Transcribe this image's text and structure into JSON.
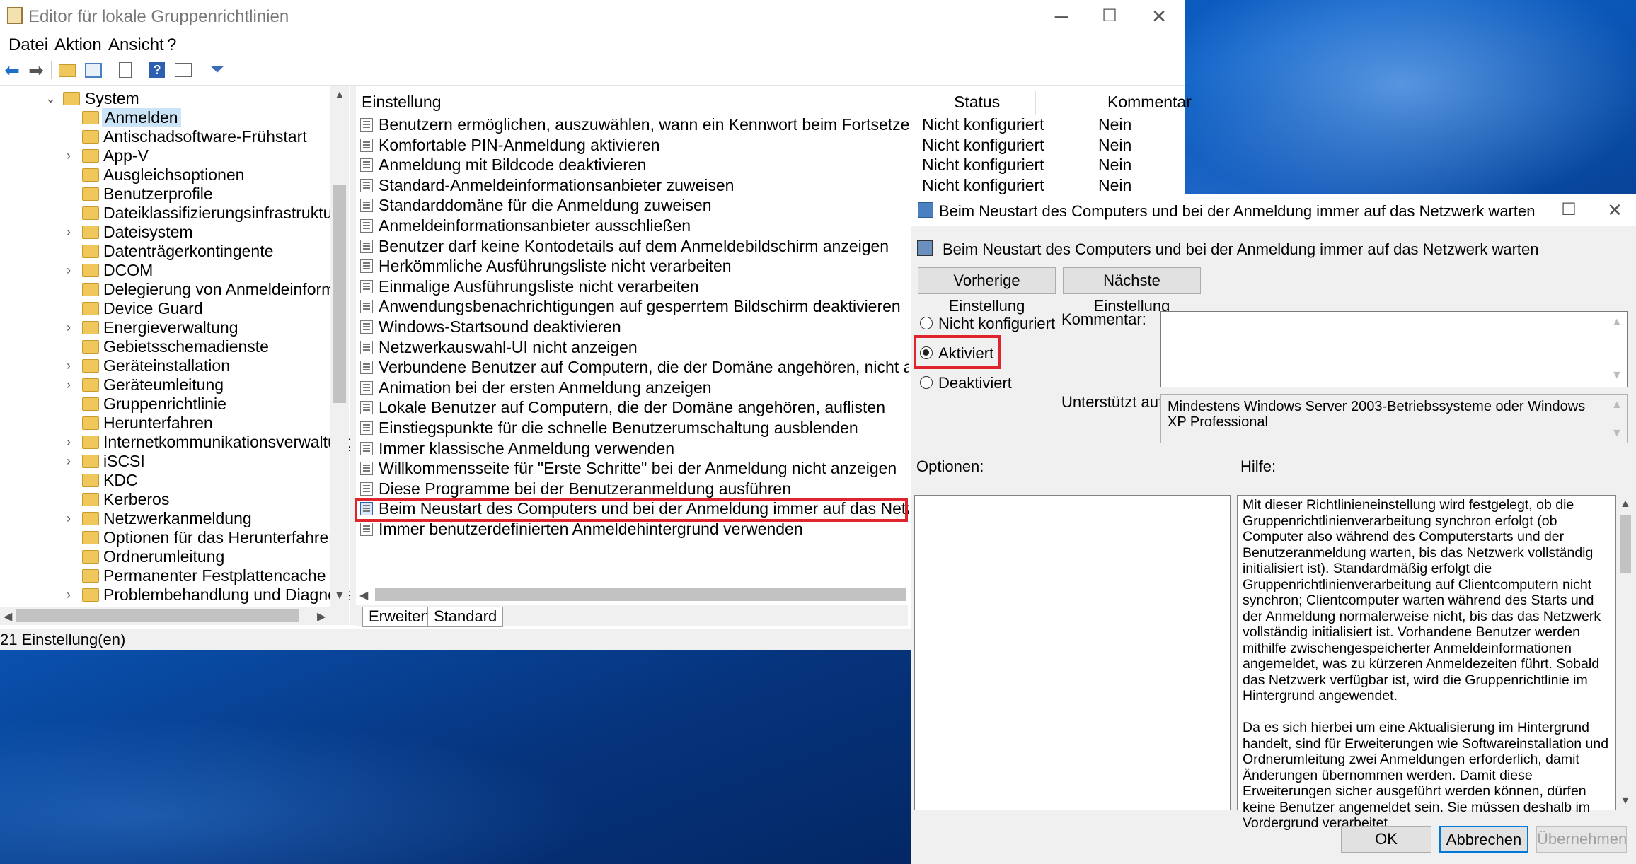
{
  "window": {
    "title": "Editor für lokale Gruppenrichtlinien",
    "minimize": "─",
    "maximize": "☐",
    "close": "✕"
  },
  "menu": {
    "items": [
      "Datei",
      "Aktion",
      "Ansicht",
      "?"
    ]
  },
  "toolbar": {
    "icons": [
      "back-icon",
      "forward-icon",
      "up-folder-icon",
      "show-hide-tree-icon",
      "export-list-icon",
      "help-icon",
      "properties-icon",
      "filter-icon"
    ]
  },
  "tree": {
    "root": "System",
    "items": [
      {
        "label": "Anmelden",
        "expandable": false,
        "selected": true
      },
      {
        "label": "Antischadsoftware-Frühstart",
        "expandable": false
      },
      {
        "label": "App-V",
        "expandable": true
      },
      {
        "label": "Ausgleichsoptionen",
        "expandable": false
      },
      {
        "label": "Benutzerprofile",
        "expandable": false
      },
      {
        "label": "Dateiklassifizierungsinfrastruktur",
        "expandable": false
      },
      {
        "label": "Dateisystem",
        "expandable": true
      },
      {
        "label": "Datenträgerkontingente",
        "expandable": false
      },
      {
        "label": "DCOM",
        "expandable": true
      },
      {
        "label": "Delegierung von Anmeldeinformationer",
        "expandable": false
      },
      {
        "label": "Device Guard",
        "expandable": false
      },
      {
        "label": "Energieverwaltung",
        "expandable": true
      },
      {
        "label": "Gebietsschemadienste",
        "expandable": false
      },
      {
        "label": "Geräteinstallation",
        "expandable": true
      },
      {
        "label": "Geräteumleitung",
        "expandable": true
      },
      {
        "label": "Gruppenrichtlinie",
        "expandable": false
      },
      {
        "label": "Herunterfahren",
        "expandable": false
      },
      {
        "label": "Internetkommunikationsverwaltung",
        "expandable": true
      },
      {
        "label": "iSCSI",
        "expandable": true
      },
      {
        "label": "KDC",
        "expandable": false
      },
      {
        "label": "Kerberos",
        "expandable": false
      },
      {
        "label": "Netzwerkanmeldung",
        "expandable": true
      },
      {
        "label": "Optionen für das Herunterfahren",
        "expandable": false
      },
      {
        "label": "Ordnerumleitung",
        "expandable": false
      },
      {
        "label": "Permanenter Festplattencache",
        "expandable": false
      },
      {
        "label": "Problembehandlung und Diagnose",
        "expandable": true
      }
    ]
  },
  "list": {
    "columns": {
      "setting": "Einstellung",
      "status": "Status",
      "comment": "Kommentar"
    },
    "rows": [
      {
        "name": "Benutzern ermöglichen, auszuwählen, wann ein Kennwort beim Fortsetzen aus dem Verbind...",
        "status": "Nicht konfiguriert",
        "comment": "Nein"
      },
      {
        "name": "Komfortable PIN-Anmeldung aktivieren",
        "status": "Nicht konfiguriert",
        "comment": "Nein"
      },
      {
        "name": "Anmeldung mit Bildcode deaktivieren",
        "status": "Nicht konfiguriert",
        "comment": "Nein"
      },
      {
        "name": "Standard-Anmeldeinformationsanbieter zuweisen",
        "status": "Nicht konfiguriert",
        "comment": "Nein"
      },
      {
        "name": "Standarddomäne für die Anmeldung zuweisen",
        "status": "",
        "comment": ""
      },
      {
        "name": "Anmeldeinformationsanbieter ausschließen",
        "status": "",
        "comment": ""
      },
      {
        "name": "Benutzer darf keine Kontodetails auf dem Anmeldebildschirm anzeigen",
        "status": "",
        "comment": ""
      },
      {
        "name": "Herkömmliche Ausführungsliste nicht verarbeiten",
        "status": "",
        "comment": ""
      },
      {
        "name": "Einmalige Ausführungsliste nicht verarbeiten",
        "status": "",
        "comment": ""
      },
      {
        "name": "Anwendungsbenachrichtigungen auf gesperrtem Bildschirm deaktivieren",
        "status": "",
        "comment": ""
      },
      {
        "name": "Windows-Startsound deaktivieren",
        "status": "",
        "comment": ""
      },
      {
        "name": "Netzwerkauswahl-UI nicht anzeigen",
        "status": "",
        "comment": ""
      },
      {
        "name": "Verbundene Benutzer auf Computern, die der Domäne angehören, nicht auflisten",
        "status": "",
        "comment": ""
      },
      {
        "name": "Animation bei der ersten Anmeldung anzeigen",
        "status": "",
        "comment": ""
      },
      {
        "name": "Lokale Benutzer auf Computern, die der Domäne angehören, auflisten",
        "status": "",
        "comment": ""
      },
      {
        "name": "Einstiegspunkte für die schnelle Benutzerumschaltung ausblenden",
        "status": "",
        "comment": ""
      },
      {
        "name": "Immer klassische Anmeldung verwenden",
        "status": "",
        "comment": ""
      },
      {
        "name": "Willkommensseite für \"Erste Schritte\" bei der Anmeldung nicht anzeigen",
        "status": "",
        "comment": ""
      },
      {
        "name": "Diese Programme bei der Benutzeranmeldung ausführen",
        "status": "",
        "comment": ""
      },
      {
        "name": "Beim Neustart des Computers und bei der Anmeldung immer auf das Netzwerk warten",
        "status": "",
        "comment": "",
        "highlighted": true
      },
      {
        "name": "Immer benutzerdefinierten Anmeldehintergrund verwenden",
        "status": "",
        "comment": ""
      }
    ]
  },
  "tabs": [
    "Erweitert",
    "Standard"
  ],
  "statusbar": {
    "text": "21 Einstellung(en)"
  },
  "dialog": {
    "title": "Beim Neustart des Computers und bei der Anmeldung immer auf das Netzwerk warten",
    "heading": "Beim Neustart des Computers und bei der Anmeldung immer auf das Netzwerk warten",
    "prev_button": "Vorherige Einstellung",
    "next_button": "Nächste Einstellung",
    "radio_not_configured": "Nicht konfiguriert",
    "radio_enabled": "Aktiviert",
    "radio_disabled": "Deaktiviert",
    "selected_option": "Aktiviert",
    "comment_label": "Kommentar:",
    "comment_value": "",
    "supported_label": "Unterstützt auf:",
    "supported_value": "Mindestens Windows Server 2003-Betriebssysteme oder Windows XP Professional",
    "options_label": "Optionen:",
    "help_label": "Hilfe:",
    "help_text": "Mit dieser Richtlinieneinstellung wird festgelegt, ob die Gruppenrichtlinienverarbeitung synchron erfolgt (ob Computer also während des Computerstarts und der Benutzeranmeldung warten, bis das Netzwerk vollständig initialisiert ist). Standardmäßig erfolgt die Gruppenrichtlinienverarbeitung auf Clientcomputern nicht synchron; Clientcomputer warten während des Starts und der Anmeldung normalerweise nicht, bis das das Netzwerk vollständig initialisiert ist. Vorhandene Benutzer werden mithilfe zwischengespeicherter Anmeldeinformationen angemeldet, was zu kürzeren Anmeldezeiten führt. Sobald das Netzwerk verfügbar ist, wird die Gruppenrichtlinie im Hintergrund angewendet.\n\nDa es sich hierbei um eine Aktualisierung im Hintergrund handelt, sind für Erweiterungen wie Softwareinstallation und Ordnerumleitung zwei Anmeldungen erforderlich, damit Änderungen übernommen werden. Damit diese Erweiterungen sicher ausgeführt werden können, dürfen keine Benutzer angemeldet sein. Sie müssen deshalb im Vordergrund verarbeitet",
    "ok_button": "OK",
    "cancel_button": "Abbrechen",
    "apply_button": "Übernehmen"
  },
  "colors": {
    "highlight": "#e0242c",
    "selection": "#cce4f7",
    "focus_border": "#0078d7"
  }
}
